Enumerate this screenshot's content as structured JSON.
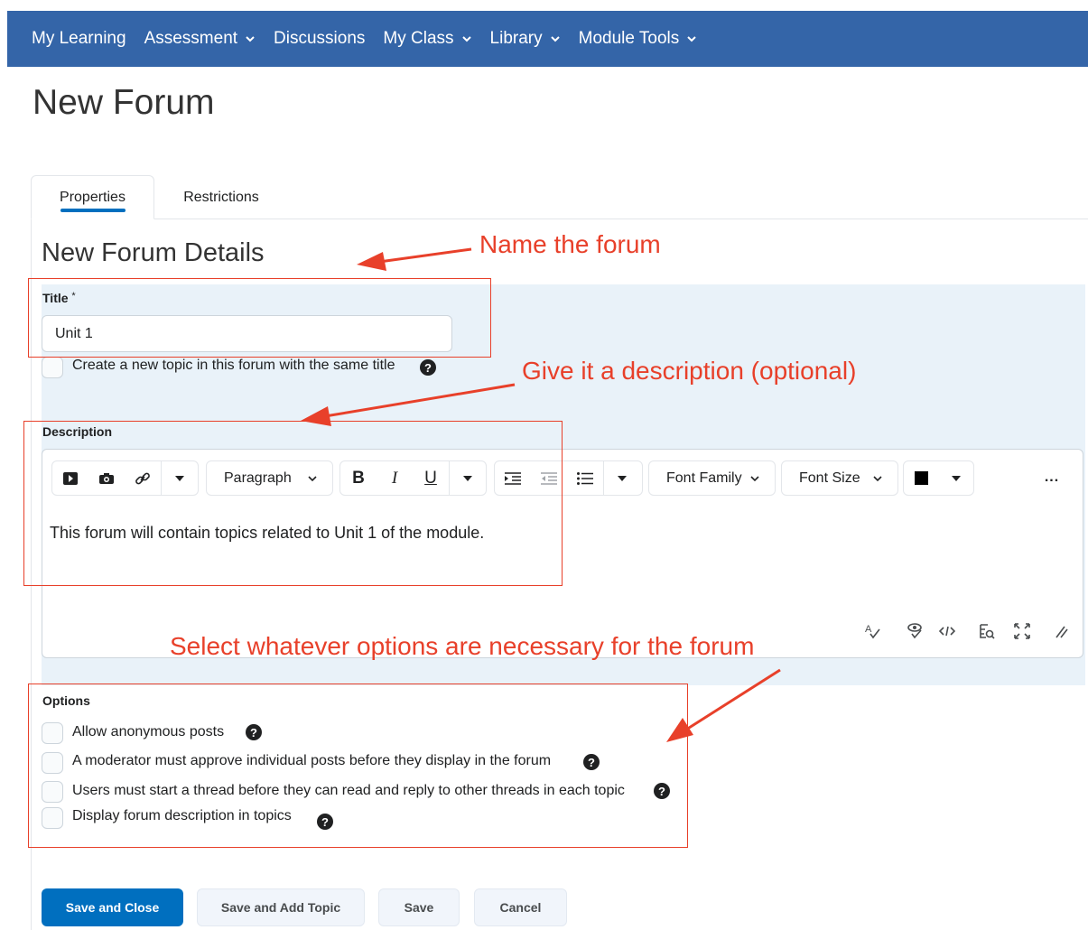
{
  "nav": {
    "items": [
      {
        "label": "My Learning",
        "has_dropdown": false
      },
      {
        "label": "Assessment",
        "has_dropdown": true
      },
      {
        "label": "Discussions",
        "has_dropdown": false
      },
      {
        "label": "My Class",
        "has_dropdown": true
      },
      {
        "label": "Library",
        "has_dropdown": true
      },
      {
        "label": "Module Tools",
        "has_dropdown": true
      }
    ],
    "color": "#3465a8"
  },
  "page_title": "New Forum",
  "tabs": [
    {
      "label": "Properties",
      "active": true
    },
    {
      "label": "Restrictions",
      "active": false
    }
  ],
  "section_title": "New Forum Details",
  "title_field": {
    "label": "Title",
    "required_mark": "*",
    "value": "Unit 1"
  },
  "same_title_checkbox": {
    "label": "Create a new topic in this forum with the same title",
    "checked": false
  },
  "description": {
    "label": "Description",
    "toolbar": {
      "paragraph": "Paragraph",
      "font_family": "Font Family",
      "font_size": "Font Size",
      "bold": "B",
      "italic": "I",
      "underline": "U",
      "more": "..."
    },
    "text": "This forum will contain topics related to Unit 1 of the module."
  },
  "options": {
    "label": "Options",
    "items": [
      {
        "label": "Allow anonymous posts",
        "checked": false
      },
      {
        "label": "A moderator must approve individual posts before they display in the forum",
        "checked": false
      },
      {
        "label": "Users must start a thread before they can read and reply to other threads in each topic",
        "checked": false
      },
      {
        "label": "Display forum description in topics",
        "checked": false
      }
    ]
  },
  "buttons": {
    "save_close": "Save and Close",
    "save_add_topic": "Save and Add Topic",
    "save": "Save",
    "cancel": "Cancel"
  },
  "annotations": {
    "name": "Name the forum",
    "description": "Give it a description (optional)",
    "options": "Select whatever options are necessary for the forum",
    "color": "#e8402a"
  },
  "icons": {
    "help": "question-circle-icon",
    "dropdown": "chevron-down-icon"
  }
}
